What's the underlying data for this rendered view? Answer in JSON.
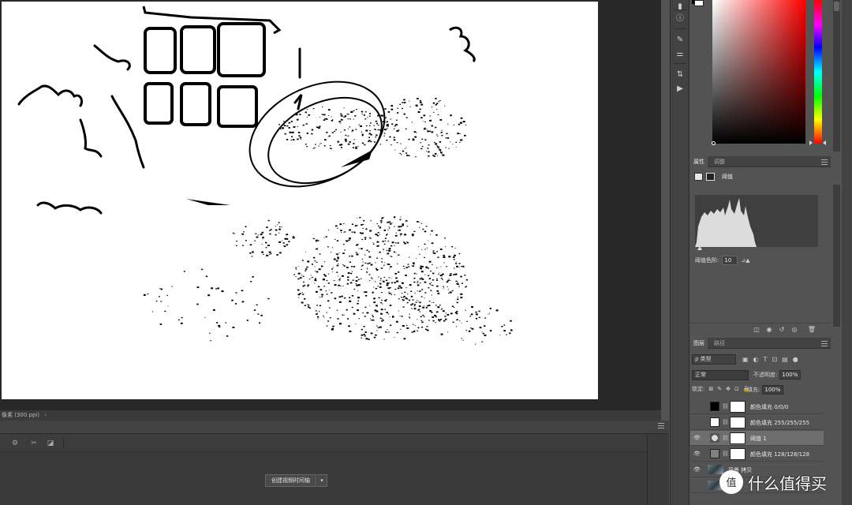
{
  "status_bar": {
    "text": "像素 (300 ppi)",
    "arrow": "›"
  },
  "timeline": {
    "create_button": "创建视频时间轴",
    "dropdown": "▾"
  },
  "icon_strip": [
    {
      "name": "color-panel-icon",
      "glyph": "▮"
    },
    {
      "name": "info-icon",
      "glyph": "ⓘ"
    },
    {
      "name": "brush-icon",
      "glyph": "✎"
    },
    {
      "name": "adjustments-icon",
      "glyph": "⚌"
    },
    {
      "name": "swap-icon",
      "glyph": "⇅"
    },
    {
      "name": "play-icon",
      "glyph": "▶"
    }
  ],
  "properties": {
    "tabs": [
      "属性",
      "调整"
    ],
    "layer_name": "阈值",
    "threshold_label": "阈值色阶:",
    "threshold_value": "10",
    "threshold_icons": "⊿▲"
  },
  "layers": {
    "tabs": [
      "图层",
      "路径"
    ],
    "filter": "ρ 类型",
    "blend_mode": "正常",
    "opacity_label": "不透明度:",
    "opacity_value": "100%",
    "lock_label": "锁定:",
    "fill_label": "填充:",
    "fill_value": "100%",
    "items": [
      {
        "name": "颜色填充 0/0/0",
        "visible": false,
        "thumb": "#000000"
      },
      {
        "name": "颜色填充 255/255/255",
        "visible": false,
        "thumb": "#ffffff"
      },
      {
        "name": "阈值 1",
        "visible": true,
        "selected": true,
        "thumb": "adjustment"
      },
      {
        "name": "颜色填充 128/128/128",
        "visible": true,
        "thumb": "#808080"
      },
      {
        "name": "背景 拷贝",
        "visible": true,
        "thumb": "photo"
      },
      {
        "name": "背景",
        "visible": false,
        "thumb": "photo"
      }
    ]
  },
  "watermark": {
    "text": "什么值得买",
    "logo": "值"
  }
}
